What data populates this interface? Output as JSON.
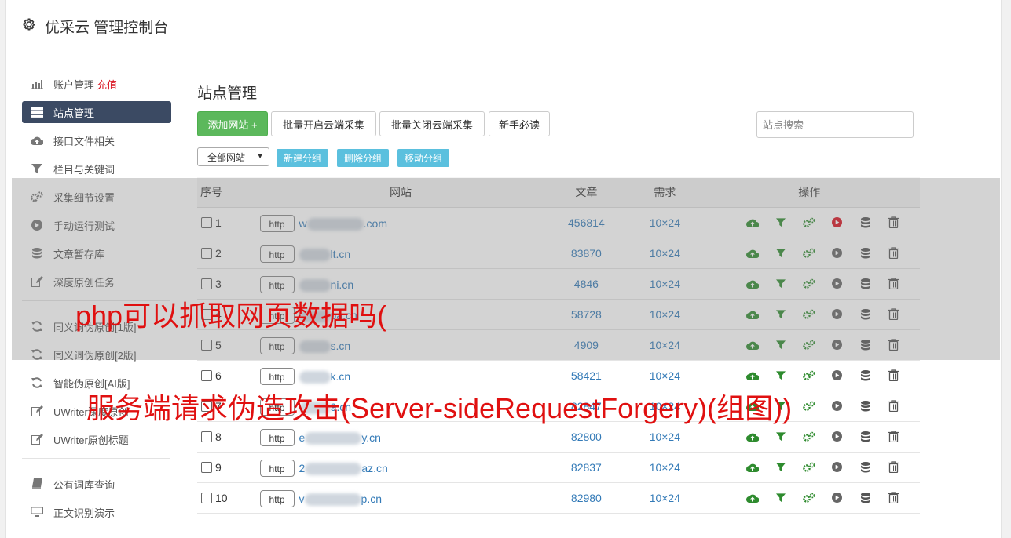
{
  "app": {
    "title": "优采云 管理控制台"
  },
  "sidebar": {
    "items": [
      {
        "label": "账户管理",
        "extra": "充值",
        "icon": "bar-chart-icon"
      },
      {
        "label": "站点管理",
        "icon": "server-icon",
        "active": true
      },
      {
        "label": "接口文件相关",
        "icon": "cloud-upload-icon"
      },
      {
        "label": "栏目与关键词",
        "icon": "filter-icon"
      },
      {
        "label": "采集细节设置",
        "icon": "cogs-icon"
      },
      {
        "label": "手动运行测试",
        "icon": "play-icon"
      },
      {
        "label": "文章暂存库",
        "icon": "database-icon"
      },
      {
        "label": "深度原创任务",
        "icon": "edit-icon"
      },
      {
        "label": "同义词伪原创[1版]",
        "icon": "refresh-icon"
      },
      {
        "label": "同义词伪原创[2版]",
        "icon": "refresh-icon"
      },
      {
        "label": "智能伪原创[AI版]",
        "icon": "refresh-icon"
      },
      {
        "label": "UWriter深度原创",
        "icon": "edit-icon"
      },
      {
        "label": "UWriter原创标题",
        "icon": "edit-icon"
      },
      {
        "label": "公有词库查询",
        "icon": "book-icon"
      },
      {
        "label": "正文识别演示",
        "icon": "desktop-icon"
      }
    ]
  },
  "main": {
    "title": "站点管理",
    "buttons": {
      "add_site": "添加网站 +",
      "batch_open": "批量开启云端采集",
      "batch_close": "批量关闭云端采集",
      "newbie": "新手必读"
    },
    "search_placeholder": "站点搜索",
    "group_select": "全部网站",
    "group_buttons": {
      "new": "新建分组",
      "delete": "删除分组",
      "move": "移动分组"
    },
    "table": {
      "headers": [
        "序号",
        "网站",
        "文章",
        "需求",
        "操作"
      ],
      "http_label": "http",
      "rows": [
        {
          "index": "1",
          "site_prefix": "w",
          "site_suffix": ".com",
          "articles": "456814",
          "demand": "10×24",
          "running": true
        },
        {
          "index": "2",
          "site_prefix": "",
          "site_suffix": "lt.cn",
          "articles": "83870",
          "demand": "10×24",
          "running": false
        },
        {
          "index": "3",
          "site_prefix": "",
          "site_suffix": "ni.cn",
          "articles": "4846",
          "demand": "10×24",
          "running": false
        },
        {
          "index": "4",
          "site_prefix": "",
          "site_suffix": "pa.cn",
          "articles": "58728",
          "demand": "10×24",
          "running": false
        },
        {
          "index": "5",
          "site_prefix": "",
          "site_suffix": "s.cn",
          "articles": "4909",
          "demand": "10×24",
          "running": false
        },
        {
          "index": "6",
          "site_prefix": "",
          "site_suffix": "k.cn",
          "articles": "58421",
          "demand": "10×24",
          "running": false
        },
        {
          "index": "7",
          "site_prefix": "",
          "site_suffix": "9.cn",
          "articles": "82847",
          "demand": "10×24",
          "running": false
        },
        {
          "index": "8",
          "site_prefix": "e",
          "site_suffix": "y.cn",
          "articles": "82800",
          "demand": "10×24",
          "running": false
        },
        {
          "index": "9",
          "site_prefix": "2",
          "site_suffix": "az.cn",
          "articles": "82837",
          "demand": "10×24",
          "running": false
        },
        {
          "index": "10",
          "site_prefix": "v",
          "site_suffix": "p.cn",
          "articles": "82980",
          "demand": "10×24",
          "running": false
        }
      ]
    }
  },
  "overlay_text": {
    "line1": "php可以抓取网页数据吗(",
    "line2": "服务端请求伪造攻击(Server-sideRequestForgery)(组图))"
  },
  "colors": {
    "accent": "#3b4a63",
    "green": "#5cb85c",
    "info": "#5bc0de",
    "link": "#337ab7",
    "red_text": "#e01010"
  }
}
